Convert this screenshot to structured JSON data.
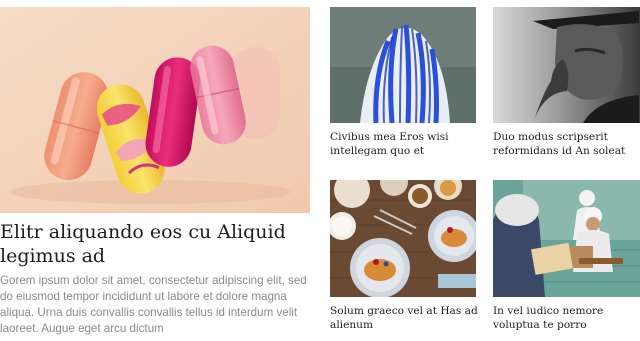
{
  "featured": {
    "image": "pills-capsules-photo",
    "title": "Elitr aliquando eos cu Aliquid legimus ad",
    "excerpt": "Gorem ipsum dolor sit amet, consectetur adipiscing elit, sed do eiusmod tempor incididunt ut labore et dolore magna aliqua. Urna duis convallis convallis tellus id interdum velit laoreet. Augue eget arcu dictum"
  },
  "cards": [
    {
      "image": "blue-sculpture-photo",
      "title": "Civibus mea Eros wisi intellegam quo et"
    },
    {
      "image": "man-portrait-bw-photo",
      "title": "Duo modus scripserit reformidans id An soleat"
    },
    {
      "image": "food-plates-photo",
      "title": "Solum graeco vel at Has ad alienum"
    },
    {
      "image": "reading-children-photo",
      "title": "In vel iudico nemore voluptua te porro"
    }
  ],
  "colors": {
    "title": "#1d1d1d",
    "excerpt": "#8a8a8a",
    "background": "#ffffff"
  }
}
